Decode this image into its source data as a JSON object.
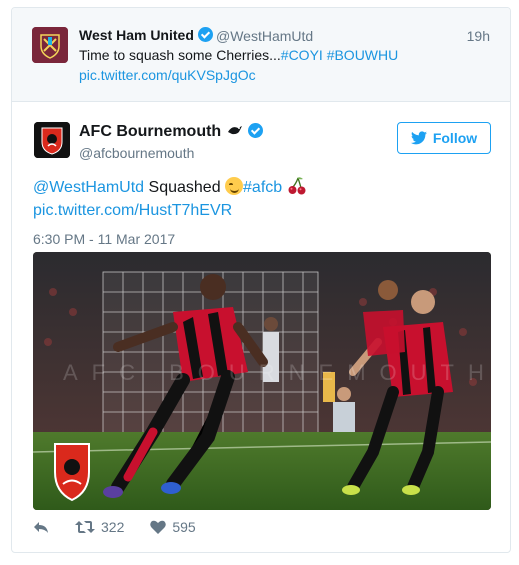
{
  "parent_tweet": {
    "name": "West Ham United",
    "handle": "@WestHamUtd",
    "time": "19h",
    "text": "Time to squash some Cherries...",
    "hashtag1": "#COYI",
    "hashtag2": "#BOUWHU",
    "pic_link": "pic.twitter.com/quKVSpJgOc",
    "avatar_icon": "west-ham-crest-icon"
  },
  "tweet": {
    "name": "AFC Bournemouth",
    "handle": "@afcbournemouth",
    "follow_label": "Follow",
    "mention": "@WestHamUtd",
    "text": " Squashed ",
    "hashtag": "#afcb",
    "pic_link": "pic.twitter.com/HustT7hEVR",
    "timestamp": "6:30 PM - 11 Mar 2017",
    "photo_watermark": "AFC BOURNEMOUTH",
    "avatar_icon": "bournemouth-crest-icon"
  },
  "actions": {
    "retweets": "322",
    "likes": "595"
  },
  "colors": {
    "link": "#1b95e0",
    "verified": "#1da1f2",
    "muted": "#657786",
    "westham": "#7a263a",
    "bournemouth_red": "#da291c"
  }
}
